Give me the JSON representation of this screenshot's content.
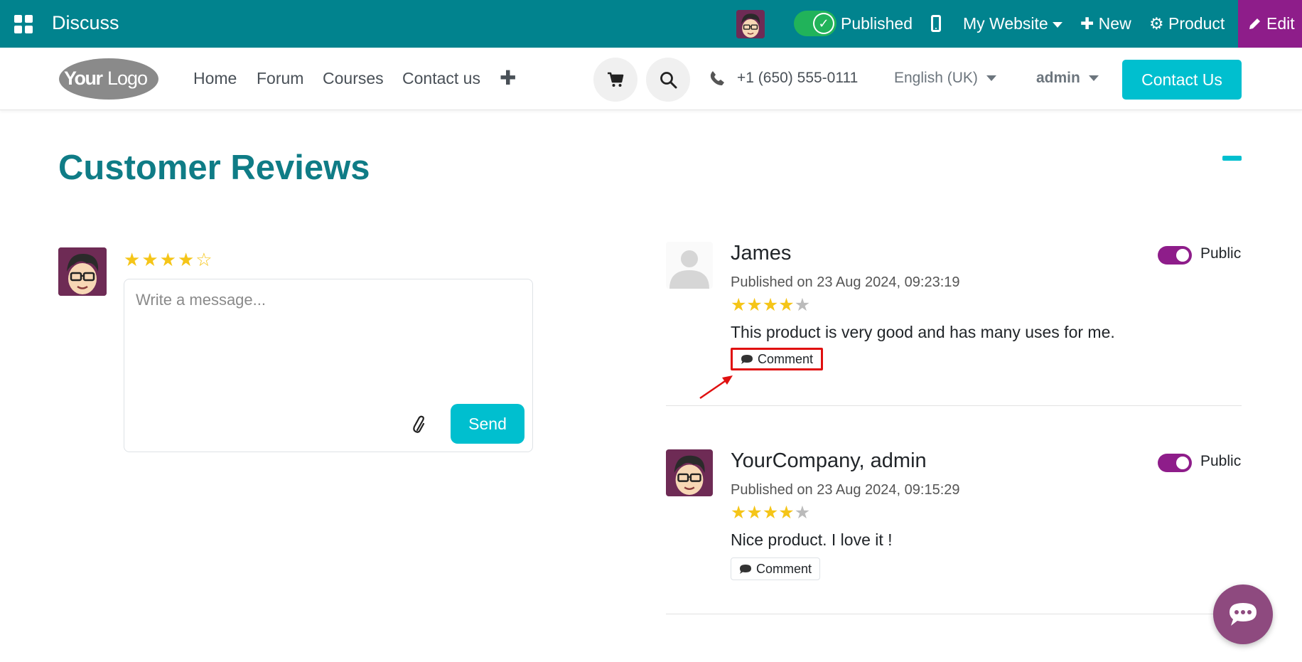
{
  "topbar": {
    "app_name": "Discuss",
    "published_label": "Published",
    "website_label": "My Website",
    "new_label": "New",
    "product_label": "Product",
    "edit_label": "Edit"
  },
  "header": {
    "logo_text": "YourLogo",
    "nav": [
      "Home",
      "Forum",
      "Courses",
      "Contact us"
    ],
    "phone": "+1 (650) 555-0111",
    "language": "English (UK)",
    "user": "admin",
    "contact_button": "Contact Us"
  },
  "main": {
    "title": "Customer Reviews",
    "composer": {
      "rating": 4,
      "max_rating": 5,
      "placeholder": "Write a message...",
      "send_label": "Send"
    },
    "reviews": [
      {
        "name": "James",
        "date": "Published on 23 Aug 2024, 09:23:19",
        "rating": 4,
        "text": "This product is very good and has many uses for me.",
        "comment_label": "Comment",
        "visibility": "Public",
        "avatar": "placeholder-person"
      },
      {
        "name": "YourCompany, admin",
        "date": "Published on 23 Aug 2024, 09:15:29",
        "rating": 4,
        "text": "Nice product. I love it !",
        "comment_label": "Comment",
        "visibility": "Public",
        "avatar": "admin-cartoon"
      }
    ]
  },
  "colors": {
    "topbar": "#01838e",
    "accent": "#00bfcf",
    "edit": "#8e1d8a",
    "title": "#0f7c86",
    "star": "#f5c518",
    "highlight": "#e01010"
  }
}
